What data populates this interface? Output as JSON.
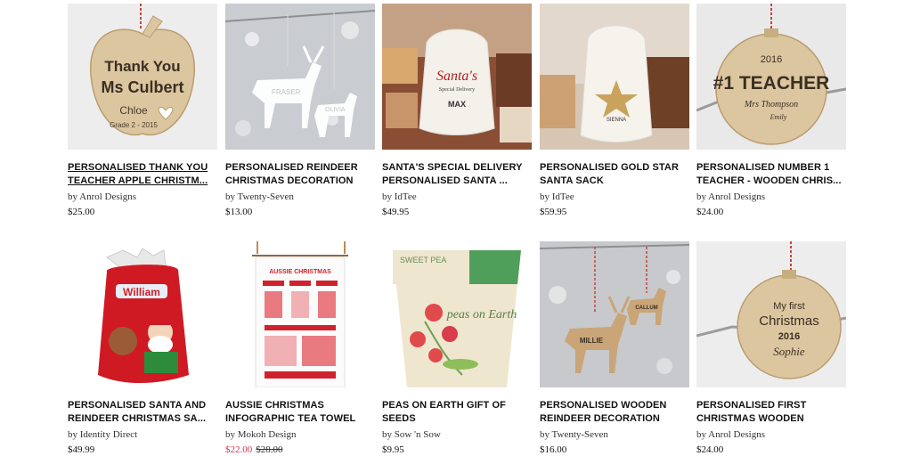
{
  "products": [
    {
      "title": "PERSONALISED THANK YOU\nTEACHER APPLE CHRISTM...",
      "brand": "by Anrol Designs",
      "price": "$25.00",
      "image_text": [
        "Thank You",
        "Ms Culbert",
        "Chloe",
        "Grade 2 - 2015"
      ]
    },
    {
      "title": "PERSONALISED REINDEER\nCHRISTMAS DECORATION",
      "brand": "by Twenty-Seven",
      "price": "$13.00",
      "image_text": [
        "FRASER",
        "OLIVIA"
      ]
    },
    {
      "title": "SANTA'S SPECIAL DELIVERY\nPERSONALISED SANTA ...",
      "brand": "by IdTee",
      "price": "$49.95",
      "image_text": [
        "Santa's",
        "Special Delivery",
        "MAX"
      ]
    },
    {
      "title": "PERSONALISED GOLD STAR\nSANTA SACK",
      "brand": "by IdTee",
      "price": "$59.95",
      "image_text": [
        "SIENNA"
      ]
    },
    {
      "title": "PERSONALISED NUMBER 1\nTEACHER - WOODEN CHRIS...",
      "brand": "by Anrol Designs",
      "price": "$24.00",
      "image_text": [
        "2016",
        "#1 TEACHER",
        "Mrs Thompson",
        "Emily"
      ]
    },
    {
      "title": "PERSONALISED SANTA AND\nREINDEER CHRISTMAS SA...",
      "brand": "by Identity Direct",
      "price": "$49.99",
      "image_text": [
        "William"
      ]
    },
    {
      "title": "AUSSIE CHRISTMAS\nINFOGRAPHIC TEA TOWEL",
      "brand": "by Mokoh Design",
      "sale_price": "$22.00",
      "original_price": "$28.00",
      "image_text": [
        "AUSSIE CHRISTMAS"
      ]
    },
    {
      "title": "PEAS ON EARTH GIFT OF\nSEEDS",
      "brand": "by Sow 'n Sow",
      "price": "$9.95",
      "image_text": [
        "SWEET PEA",
        "peas on Earth"
      ]
    },
    {
      "title": "PERSONALISED WOODEN\nREINDEER DECORATION",
      "brand": "by Twenty-Seven",
      "price": "$16.00",
      "image_text": [
        "MILLIE",
        "CALLUM"
      ]
    },
    {
      "title": "PERSONALISED FIRST\nCHRISTMAS WOODEN",
      "brand": "by Anrol Designs",
      "price": "$24.00",
      "image_text": [
        "My first",
        "Christmas",
        "2016",
        "Sophie"
      ]
    }
  ],
  "colors": {
    "sale": "#d9304a",
    "text": "#111111",
    "wood": "#d9c29a",
    "red": "#c8102e"
  }
}
